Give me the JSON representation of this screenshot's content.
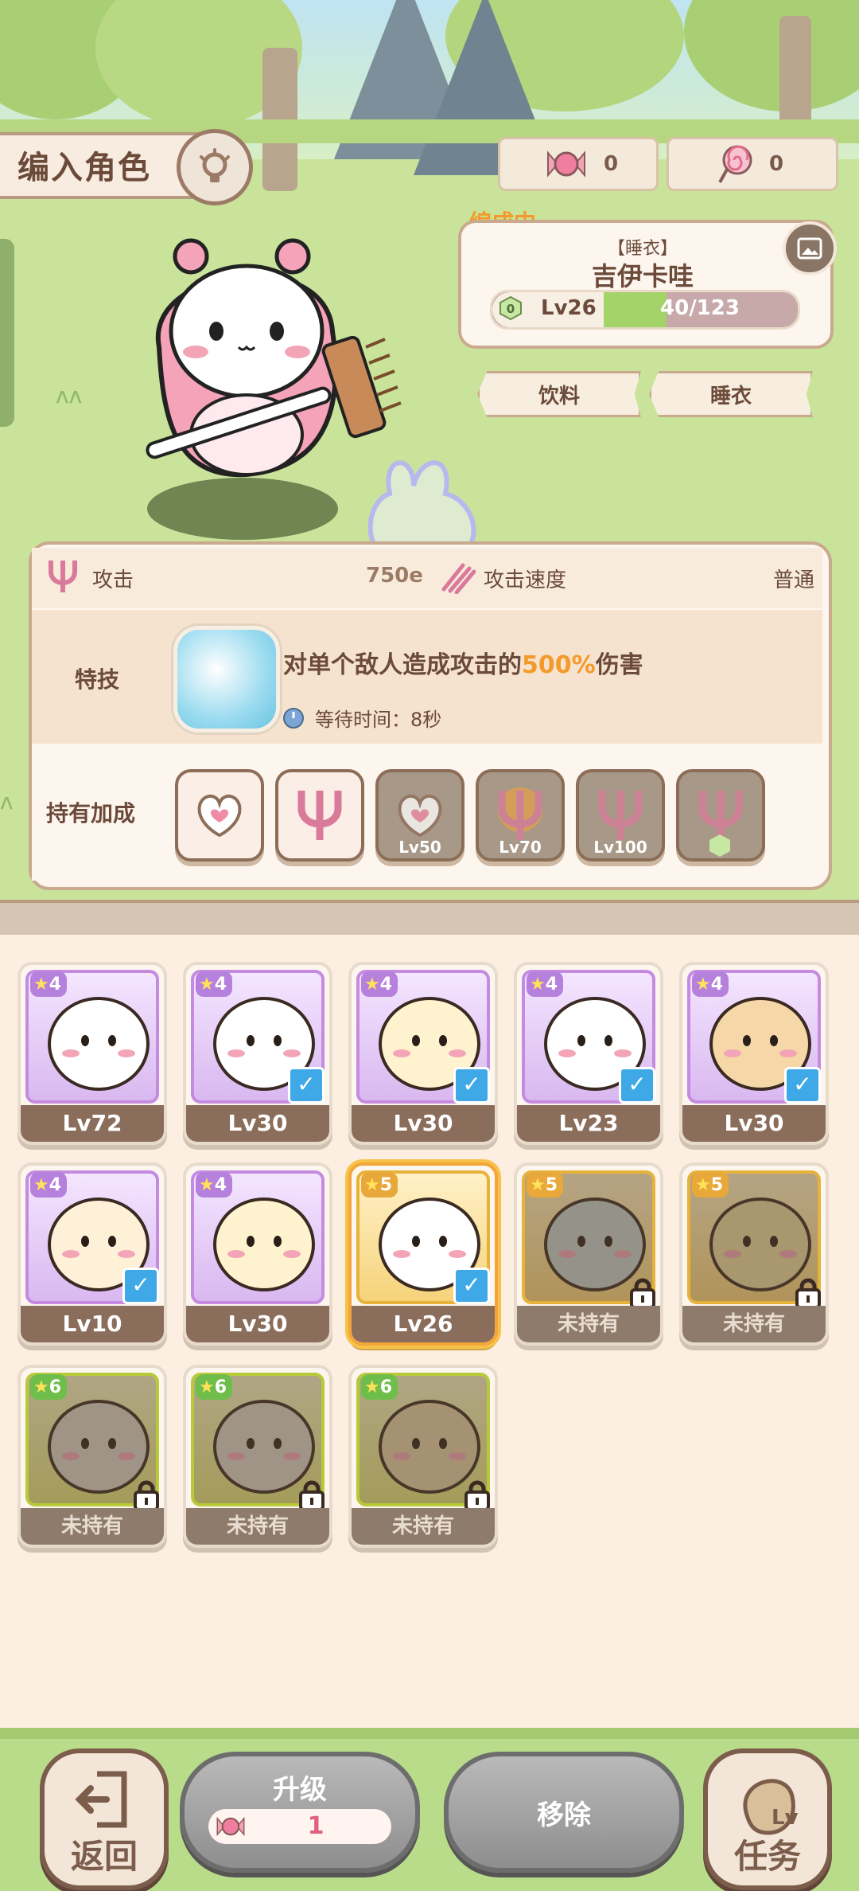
{
  "header": {
    "title": "编入角色"
  },
  "currency": [
    {
      "icon": "candy-icon",
      "value": "0"
    },
    {
      "icon": "lollipop-icon",
      "value": "0"
    }
  ],
  "selected": {
    "status": "编成中",
    "costume": "【睡衣】",
    "name": "吉伊卡哇",
    "level": "Lv26",
    "exp": "40/123",
    "exp_ratio": 0.325,
    "tags": [
      "饮料",
      "睡衣"
    ]
  },
  "stats": {
    "attack_label": "攻击",
    "attack_value": "750e",
    "speed_label": "攻击速度",
    "speed_value": "普通"
  },
  "skill": {
    "label": "特技",
    "desc_prefix": "对单个敌人造成攻击的",
    "desc_highlight": "500%",
    "desc_suffix": "伤害",
    "wait": "等待时间：8秒"
  },
  "bonus": {
    "label": "持有加成",
    "items": [
      {
        "icon": "heart-icon",
        "label": ""
      },
      {
        "icon": "fork-icon",
        "label": ""
      },
      {
        "icon": "heart-icon",
        "label": "Lv50"
      },
      {
        "icon": "fork-burst-icon",
        "label": "Lv70"
      },
      {
        "icon": "fork-icon",
        "label": "Lv100"
      },
      {
        "icon": "fork-icon",
        "label": ""
      }
    ]
  },
  "roster": [
    {
      "stars": "4",
      "level": "Lv72",
      "owned": true,
      "checked": false
    },
    {
      "stars": "4",
      "level": "Lv30",
      "owned": true,
      "checked": true
    },
    {
      "stars": "4",
      "level": "Lv30",
      "owned": true,
      "checked": true
    },
    {
      "stars": "4",
      "level": "Lv23",
      "owned": true,
      "checked": true
    },
    {
      "stars": "4",
      "level": "Lv30",
      "owned": true,
      "checked": true
    },
    {
      "stars": "4",
      "level": "Lv10",
      "owned": true,
      "checked": true
    },
    {
      "stars": "4",
      "level": "Lv30",
      "owned": true,
      "checked": false
    },
    {
      "stars": "5",
      "level": "Lv26",
      "owned": true,
      "checked": true
    },
    {
      "stars": "5",
      "level": "未持有",
      "owned": false,
      "checked": false
    },
    {
      "stars": "5",
      "level": "未持有",
      "owned": false,
      "checked": false
    },
    {
      "stars": "6",
      "level": "未持有",
      "owned": false,
      "checked": false
    },
    {
      "stars": "6",
      "level": "未持有",
      "owned": false,
      "checked": false
    },
    {
      "stars": "6",
      "level": "未持有",
      "owned": false,
      "checked": false
    }
  ],
  "footer": {
    "back": "返回",
    "upgrade": "升级",
    "upgrade_cost": "1",
    "remove": "移除",
    "tasks": "任务",
    "tasks_badge": "Lv"
  },
  "colors": {
    "accent": "#f39a2a",
    "exp_fill": "#a4d36a",
    "check": "#3fa8e6"
  }
}
